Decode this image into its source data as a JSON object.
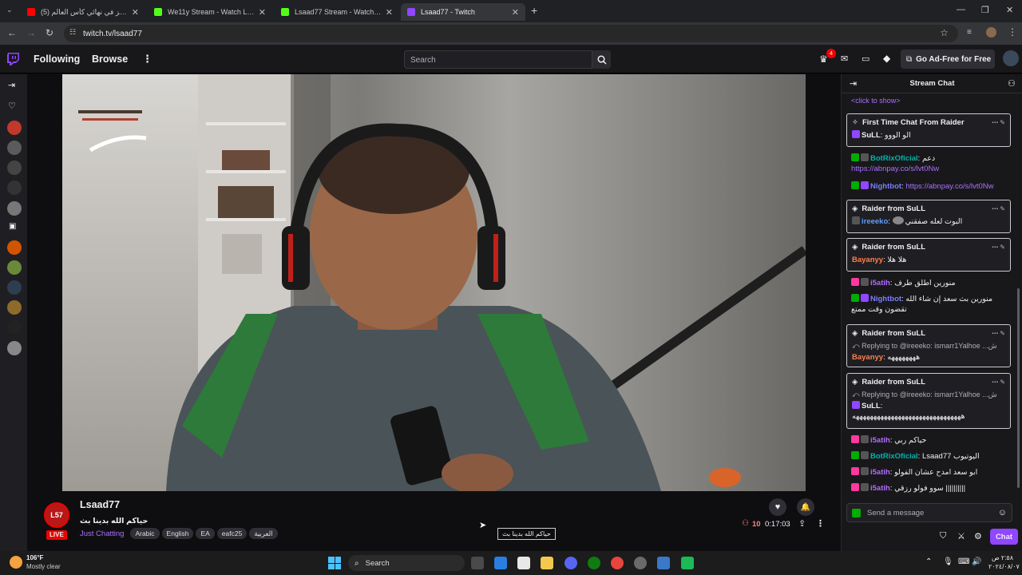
{
  "browser": {
    "tabs": [
      {
        "title": "(5) فالكونز في نهائي كأس العالم",
        "favicon_color": "#ff0000",
        "active": false
      },
      {
        "title": "We11y Stream - Watch Live on",
        "favicon_color": "#53fc18",
        "active": false
      },
      {
        "title": "Lsaad77 Stream - Watch Live o",
        "favicon_color": "#53fc18",
        "active": false
      },
      {
        "title": "Lsaad77 - Twitch",
        "favicon_color": "#9146ff",
        "active": true
      }
    ],
    "new_tab": "+",
    "url": "twitch.tv/lsaad77"
  },
  "nav": {
    "following": "Following",
    "browse": "Browse",
    "search_placeholder": "Search",
    "notification_count": "4",
    "ad_free": "Go Ad-Free for Free"
  },
  "stream": {
    "channel": "Lsaad77",
    "title": "حياكم الله بدينا بث",
    "category": "Just Chatting",
    "tags": [
      "Arabic",
      "English",
      "EA",
      "eafc25",
      "العربية"
    ],
    "viewers": "10",
    "uptime": "0:17:03",
    "live_badge": "LIVE",
    "avatar_text": "L57",
    "tooltip": "حياكم الله بدينا بث"
  },
  "chat": {
    "header": "Stream Chat",
    "click_to_show": "<click to show>",
    "input_placeholder": "Send a message",
    "chat_button": "Chat",
    "items": [
      {
        "kind": "card",
        "head": "First Time Chat From Raider",
        "user": "SuLL",
        "user_color": "#efeff1",
        "text": "الو الووو"
      },
      {
        "kind": "line",
        "user": "BotRixOficial",
        "user_color": "#00b5ad",
        "text": "دعم ",
        "link": "https://abnpay.co/s/lvt0Nw"
      },
      {
        "kind": "line",
        "user": "Nightbot",
        "user_color": "#7c7cff",
        "text": "",
        "link": "https://abnpay.co/s/lvt0Nw"
      },
      {
        "kind": "card",
        "head": "Raider from SuLL",
        "user": "ireeeko",
        "user_color": "#5c9dff",
        "text": "البوت لعله صفقني"
      },
      {
        "kind": "card",
        "head": "Raider from SuLL",
        "user": "Bayanyy",
        "user_color": "#ff7f50",
        "text": "هلا هلا"
      },
      {
        "kind": "line",
        "user": "i5atih",
        "user_color": "#b36bff",
        "text": "منورين اطلق طرف"
      },
      {
        "kind": "line",
        "user": "Nightbot",
        "user_color": "#7c7cff",
        "text": "منورين بث سعد إن شاء الله تقضون وقت ممتع"
      },
      {
        "kind": "card",
        "head": "Raider from SuLL",
        "reply": "Replying to @ireeeko: ismarr1Yalhoe ...ش",
        "user": "Bayanyy",
        "user_color": "#ff7f50",
        "text": "ههههههههه"
      },
      {
        "kind": "card",
        "head": "Raider from SuLL",
        "reply": "Replying to @ireeeko: ismarr1Yalhoe ...ش",
        "user": "SuLL",
        "user_color": "#efeff1",
        "text": "هههههههههههههههههههههههههههههههه"
      },
      {
        "kind": "line",
        "user": "i5atih",
        "user_color": "#b36bff",
        "text": "حياكم ربي"
      },
      {
        "kind": "line",
        "user": "BotRixOficial",
        "user_color": "#00b5ad",
        "text": "Lsaad77 اليوتيوب"
      },
      {
        "kind": "line",
        "user": "i5atih",
        "user_color": "#b36bff",
        "text": "ابو سعد امدح عشان الفولو"
      },
      {
        "kind": "line",
        "user": "i5atih",
        "user_color": "#b36bff",
        "text": "سوو فولو رزقي ||||||||||"
      }
    ]
  },
  "taskbar": {
    "weather_temp": "106°F",
    "weather_desc": "Mostly clear",
    "search": "Search",
    "time": "٢:٥٨ ص",
    "date": "٢٠٢٤/٠٨/٠٧"
  },
  "colors": {
    "twitch_purple": "#9146ff",
    "link_purple": "#a970ff",
    "live_red": "#eb0400"
  }
}
